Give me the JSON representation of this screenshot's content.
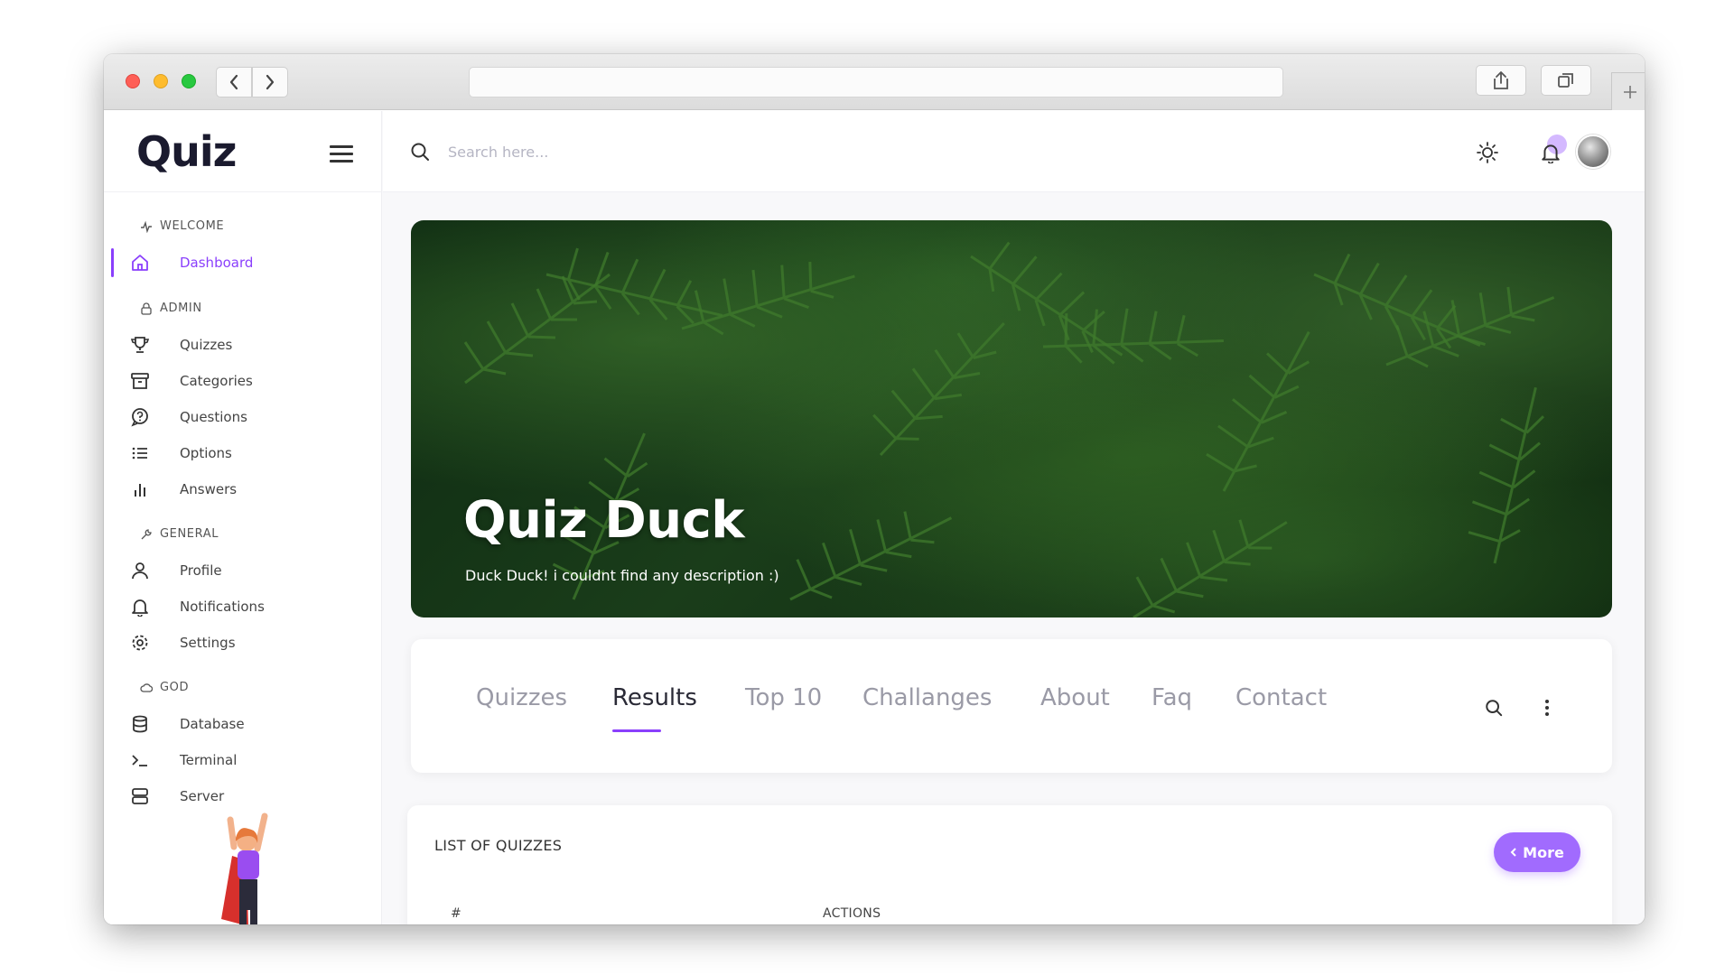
{
  "app": {
    "logo_text": "Quiz",
    "accent_color": "#8a3ffc"
  },
  "topbar": {
    "search_placeholder": "Search here..."
  },
  "sidebar": {
    "sections": [
      {
        "label": "WELCOME",
        "icon": "activity-icon"
      },
      {
        "label": "ADMIN",
        "icon": "lock-icon"
      },
      {
        "label": "GENERAL",
        "icon": "wrench-icon"
      },
      {
        "label": "GOD",
        "icon": "cloud-icon"
      }
    ],
    "items": [
      {
        "label": "Dashboard",
        "icon": "home-icon",
        "active": true
      },
      {
        "label": "Quizzes",
        "icon": "trophy-icon"
      },
      {
        "label": "Categories",
        "icon": "archive-icon"
      },
      {
        "label": "Questions",
        "icon": "question-chat-icon"
      },
      {
        "label": "Options",
        "icon": "list-icon"
      },
      {
        "label": "Answers",
        "icon": "bar-chart-icon"
      },
      {
        "label": "Profile",
        "icon": "user-icon"
      },
      {
        "label": "Notifications",
        "icon": "bell-icon"
      },
      {
        "label": "Settings",
        "icon": "gear-icon"
      },
      {
        "label": "Database",
        "icon": "database-icon"
      },
      {
        "label": "Terminal",
        "icon": "terminal-icon"
      },
      {
        "label": "Server",
        "icon": "server-icon"
      }
    ]
  },
  "hero": {
    "title": "Quiz Duck",
    "description": "Duck Duck! i couldnt find any description :)"
  },
  "tabs": {
    "items": [
      "Quizzes",
      "Results",
      "Top 10",
      "Challanges",
      "About",
      "Faq",
      "Contact"
    ],
    "active": "Results"
  },
  "list": {
    "title": "LIST OF QUIZZES",
    "more_label": "More",
    "columns": [
      "#",
      "ACTIONS"
    ]
  }
}
